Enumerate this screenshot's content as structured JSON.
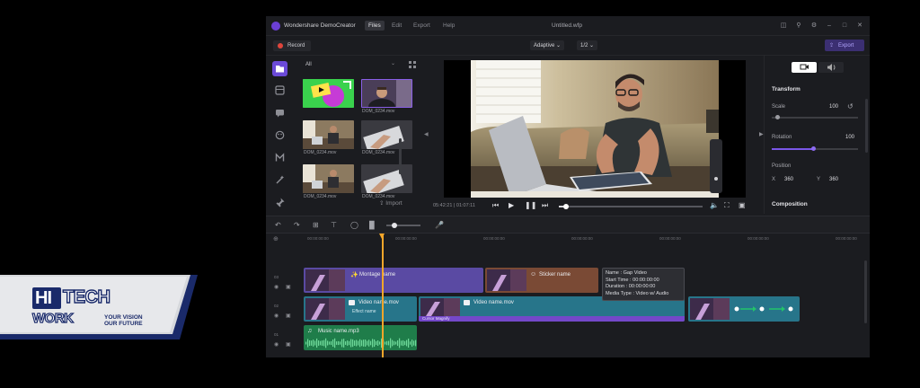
{
  "window": {
    "app_title": "Wondershare DemoCreator",
    "file_title": "Untitled.wfp",
    "menu": [
      "Files",
      "Edit",
      "Export",
      "Help"
    ],
    "active_menu": "Files"
  },
  "toolbar": {
    "record_label": "Record",
    "adaptive_label": "Adaptive",
    "ratio_label": "1/2",
    "export_label": "Export"
  },
  "media": {
    "filter_label": "All",
    "import_label": "Import",
    "items": [
      {
        "label": ""
      },
      {
        "label": "DOM_0234.mov"
      },
      {
        "label": "DOM_0234.mov"
      },
      {
        "label": "DOM_0234.mov"
      },
      {
        "label": "DOM_0234.mov"
      },
      {
        "label": "DOM_0234.mov"
      }
    ]
  },
  "playback": {
    "timecode": "05:42:21 | 01:07:11",
    "progress": 0.05
  },
  "properties": {
    "transform_title": "Transform",
    "scale_label": "Scale",
    "scale_value": "100",
    "rotation_label": "Rotation",
    "rotation_value": "100",
    "position_label": "Position",
    "pos_x_label": "X",
    "pos_x_value": "360",
    "pos_y_label": "Y",
    "pos_y_value": "360",
    "composition_title": "Composition"
  },
  "timeline": {
    "ruler_labels": [
      "00:00:00:00",
      "00:00:00:00",
      "00:00:00:00",
      "00:00:00:00",
      "00:00:00:00",
      "00:00:00:00",
      "00:00:00:00"
    ],
    "track_numbers": [
      "03",
      "02",
      "01"
    ],
    "clips": {
      "montage": "Montage name",
      "sticker": "Sticker name",
      "video1": "Video name.mov",
      "effect": "Effect name",
      "video2": "Video name.mov",
      "cursor": "Cursor Magnify",
      "music": "Music name.mp3"
    },
    "tooltip": {
      "name": "Name : Gap Video",
      "start": "Start Time : 00:00:00:00",
      "duration": "Duration : 00:00:00:00",
      "media_type": "Media Type : Video w/ Audio"
    }
  },
  "badge": {
    "brand_hi": "HI",
    "brand_tech": "TECH",
    "brand_work": "WORK",
    "tagline_1": "YOUR VISION",
    "tagline_2": "OUR FUTURE"
  },
  "colors": {
    "accent": "#7a57e8",
    "record_red": "#e0453c",
    "montage_clip": "#5a4aa3",
    "sticker_clip": "#7a4a35",
    "video_clip": "#27758a",
    "cursor_clip": "#7448c9",
    "audio_clip": "#1f7d4a",
    "playhead": "#f4a62a"
  }
}
